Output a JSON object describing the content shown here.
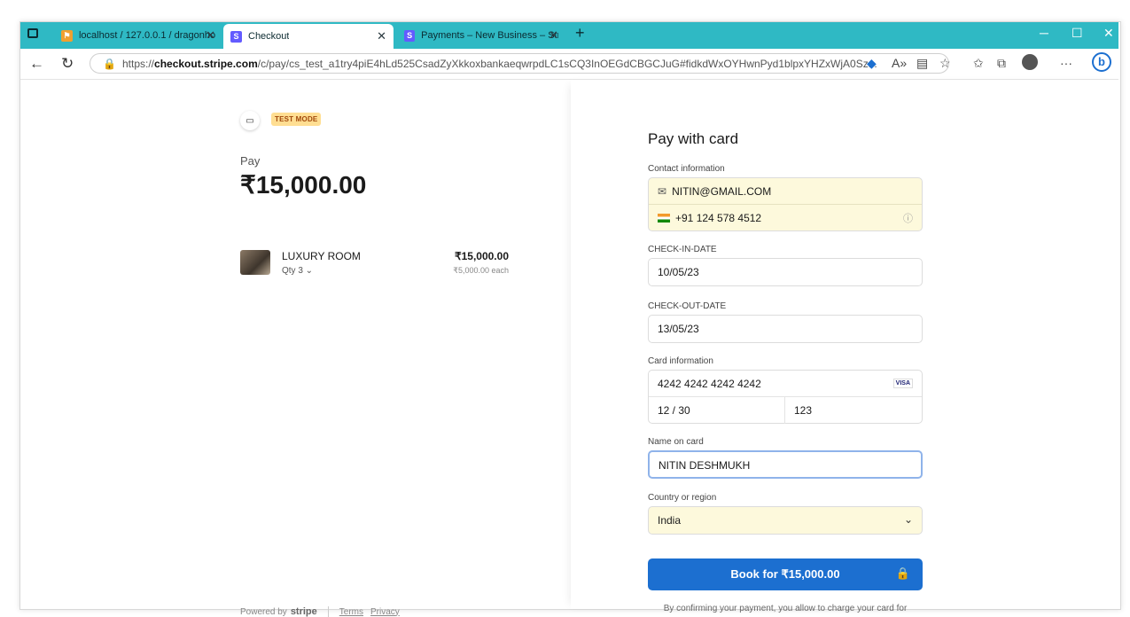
{
  "browser": {
    "tabs": [
      {
        "label": "localhost / 127.0.0.1 / dragonho",
        "favicon": "phpmyadmin-icon"
      },
      {
        "label": "Checkout",
        "favicon": "stripe-s-icon"
      },
      {
        "label": "Payments – New Business – Strip",
        "favicon": "stripe-s-icon"
      }
    ],
    "url_prefix": "https://",
    "url_domain": "checkout.stripe.com",
    "url_rest": "/c/pay/cs_test_a1try4piE4hLd525CsadZyXkkoxbankaeqwrpdLC1sCQ3InOEGdCBGCJuG#fidkdWxOYHwnPyd1blpxYHZxWjA0Sz...",
    "accent": "#2fb9c4"
  },
  "summary": {
    "test_mode": "TEST MODE",
    "pay_label": "Pay",
    "amount": "₹15,000.00",
    "item_name": "LUXURY ROOM",
    "item_qty": "Qty 3 ⌄",
    "item_price": "₹15,000.00",
    "item_each": "₹5,000.00 each",
    "powered_by": "Powered by",
    "brand": "stripe",
    "terms": "Terms",
    "privacy": "Privacy"
  },
  "form": {
    "title": "Pay with card",
    "contact_label": "Contact information",
    "email": "NITIN@GMAIL.COM",
    "phone": "+91 124 578 4512",
    "checkin_label": "CHECK-IN-DATE",
    "checkin": "10/05/23",
    "checkout_label": "CHECK-OUT-DATE",
    "checkout": "13/05/23",
    "card_label": "Card information",
    "card_number": "4242 4242 4242 4242",
    "card_brand": "VISA",
    "expiry": "12 / 30",
    "cvc": "123",
    "name_label": "Name on card",
    "name": "NITIN DESHMUKH",
    "country_label": "Country or region",
    "country": "India",
    "submit": "Book for ₹15,000.00",
    "consent": "By confirming your payment, you allow to charge your card for"
  },
  "colors": {
    "button": "#1c6fd0",
    "test_badge": "#ffde92",
    "autofill": "#fdf9dc"
  }
}
